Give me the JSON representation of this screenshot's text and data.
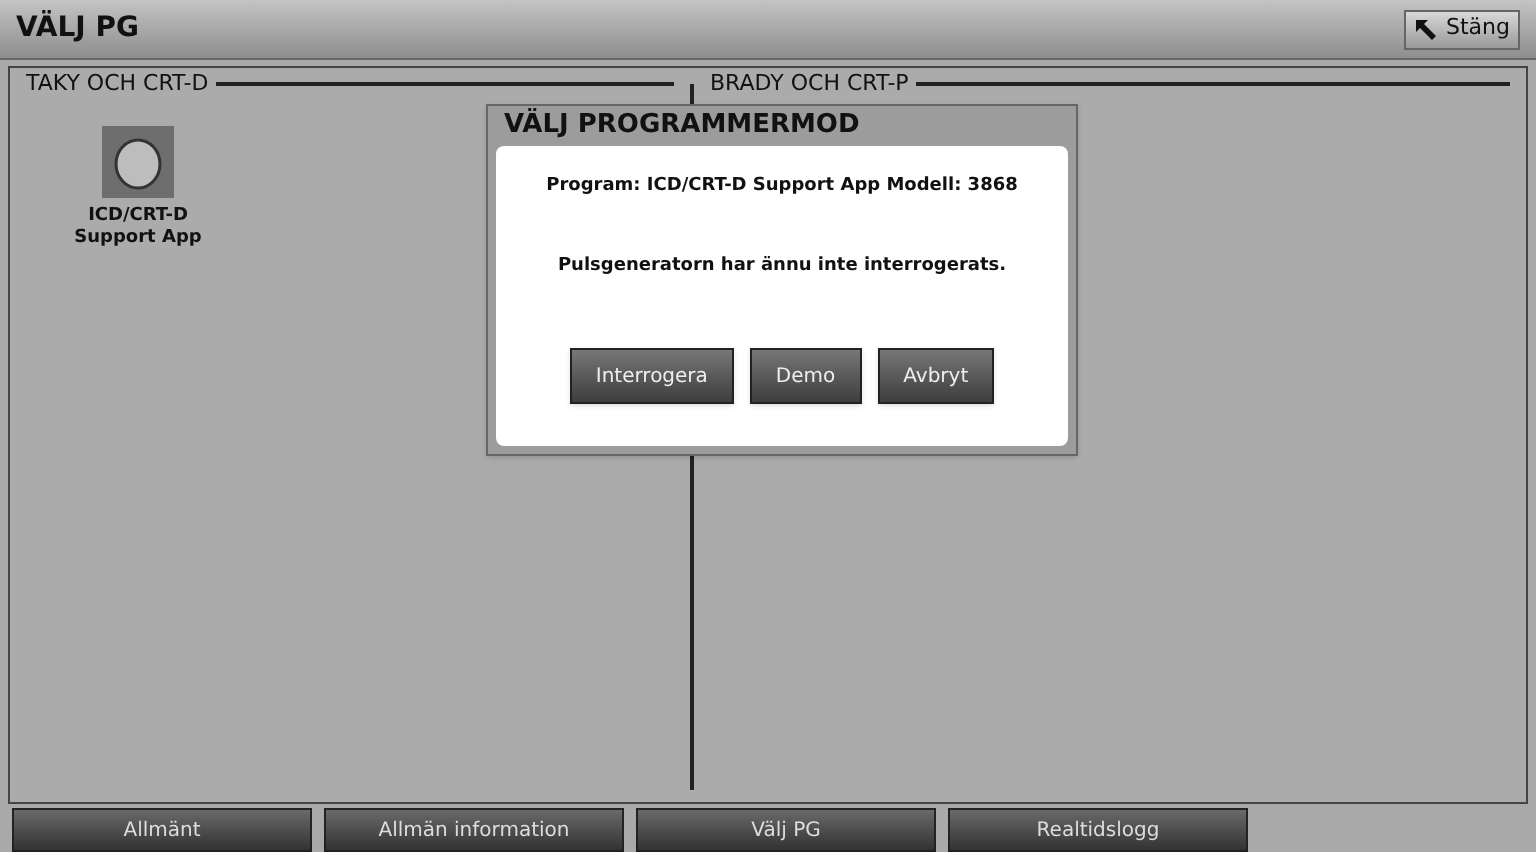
{
  "window": {
    "title": "VÄLJ PG",
    "close_button": "Stäng"
  },
  "groups": [
    {
      "title": "TAKY OCH CRT-D",
      "apps": [
        {
          "label": "ICD/CRT-D Support App"
        }
      ]
    },
    {
      "title": "BRADY OCH CRT-P"
    }
  ],
  "dialog": {
    "title": "VÄLJ PROGRAMMERMOD",
    "lines": [
      "Program: ICD/CRT-D Support App Modell: 3868",
      "Pulsgeneratorn har ännu inte interrogerats."
    ],
    "buttons": [
      "Interrogera",
      "Demo",
      "Avbryt"
    ]
  },
  "bottom_tabs": [
    {
      "label": "Allmänt"
    },
    {
      "label": "Allmän information"
    },
    {
      "label": "Välj PG"
    },
    {
      "label": "Realtidslogg"
    }
  ]
}
